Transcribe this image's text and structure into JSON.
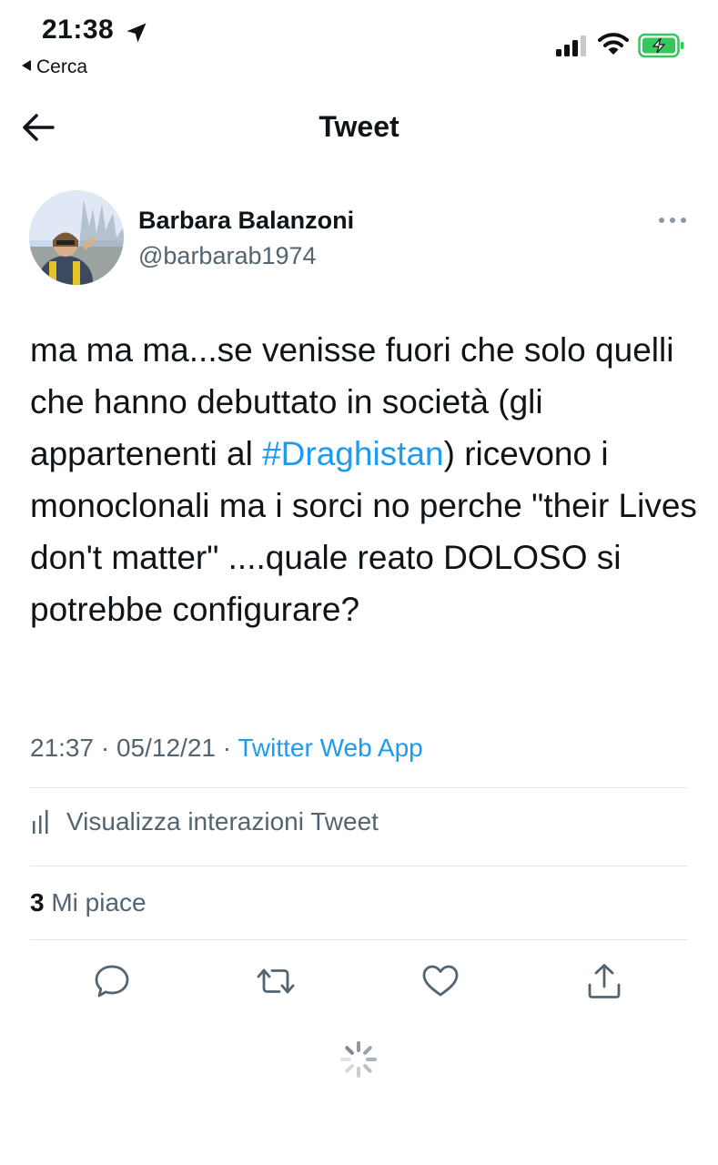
{
  "status_bar": {
    "time": "21:38",
    "back_app_label": "Cerca",
    "battery_color": "#34c759"
  },
  "header": {
    "title": "Tweet"
  },
  "author": {
    "name": "Barbara Balanzoni",
    "handle": "@barbarab1974"
  },
  "tweet": {
    "text_before_hashtag": "ma ma ma...se venisse fuori che solo quelli che hanno debuttato in società (gli appartenenti al ",
    "hashtag": "#Draghistan",
    "text_after_hashtag": ") ricevono i monoclonali ma i sorci no perche \"their Lives don't matter\" ....quale reato DOLOSO si potrebbe configurare?",
    "time": "21:37",
    "date": "05/12/21",
    "source": "Twitter Web App"
  },
  "analytics_label": "Visualizza interazioni Tweet",
  "likes": {
    "count": "3",
    "label": "Mi piace"
  },
  "colors": {
    "accent": "#1d9bf0",
    "secondary_text": "#536471"
  },
  "icons": [
    "location-arrow-icon",
    "signal-icon",
    "wifi-icon",
    "battery-icon",
    "back-arrow-icon",
    "more-icon",
    "analytics-icon",
    "reply-icon",
    "retweet-icon",
    "like-icon",
    "share-icon",
    "loading-spinner-icon"
  ]
}
